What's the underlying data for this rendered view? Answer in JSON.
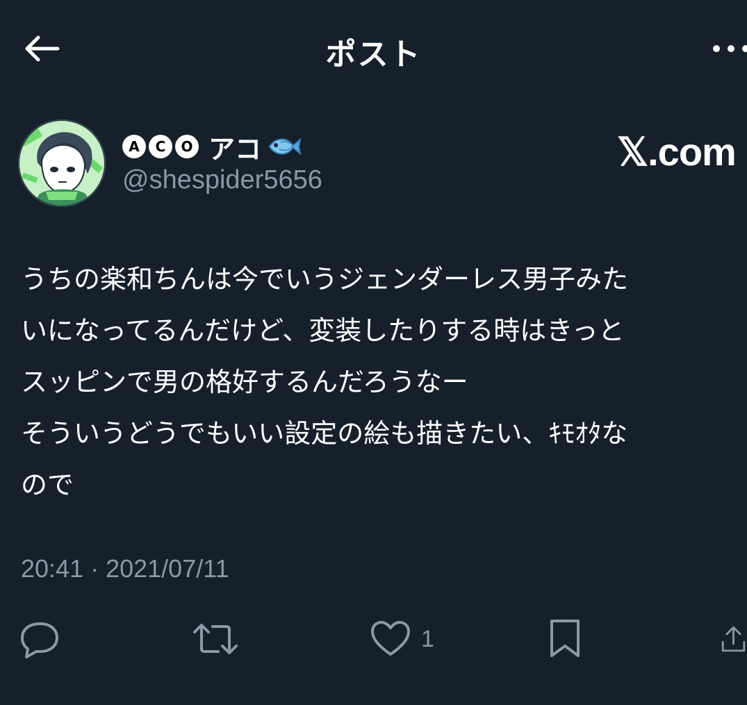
{
  "header": {
    "title": "ポスト",
    "back_icon": "arrow-left-icon",
    "more_icon": "more-horizontal-icon"
  },
  "author": {
    "badges": [
      "A",
      "C",
      "O"
    ],
    "display_name": "アコ",
    "name_emoji": "fish-emoji",
    "handle": "@shespider5656"
  },
  "watermark": "𝕏.com",
  "post": {
    "lines": [
      "うちの楽和ちんは今でいうジェンダーレス男子みた",
      "いになってるんだけど、変装したりする時はきっと",
      "スッピンで男の格好するんだろうなー",
      "そういうどうでもいい設定の絵も描きたい、ｷﾓｵﾀな",
      "ので"
    ],
    "timestamp": "20:41 · 2021/07/11"
  },
  "actions": {
    "reply_icon": "reply-icon",
    "repost_icon": "repost-icon",
    "like_icon": "heart-icon",
    "like_count": "1",
    "bookmark_icon": "bookmark-icon",
    "share_icon": "share-icon"
  },
  "colors": {
    "background": "#15202b",
    "text_primary": "#ffffff",
    "text_secondary": "#8b98a5"
  }
}
